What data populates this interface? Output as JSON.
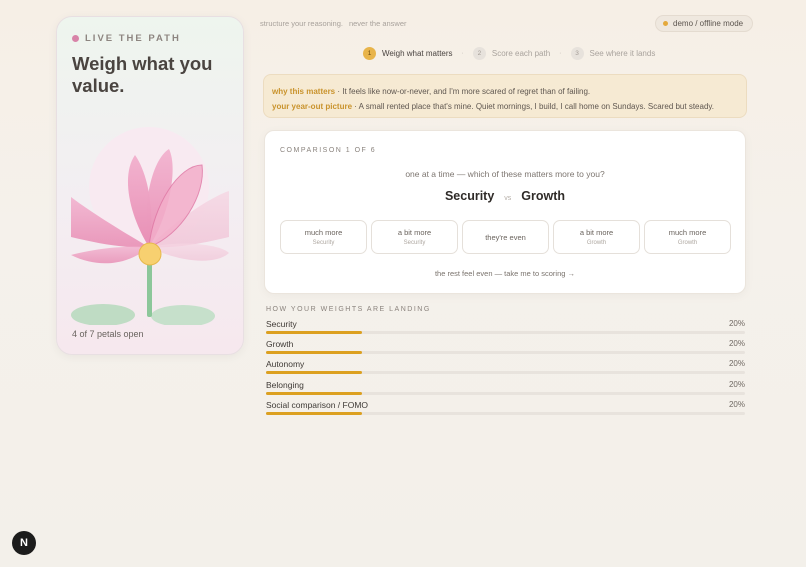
{
  "brand": {
    "label": "LIVE THE PATH"
  },
  "left": {
    "title": "Weigh what you value.",
    "petal_count": "4 of 7 petals open"
  },
  "topbar": {
    "tagline_a": "structure your reasoning.",
    "tagline_b": "never the answer",
    "mode_label": "demo / offline mode"
  },
  "steps": [
    {
      "num": "1",
      "label": "Weigh what matters",
      "active": true
    },
    {
      "num": "2",
      "label": "Score each path",
      "active": false
    },
    {
      "num": "3",
      "label": "See where it lands",
      "active": false
    }
  ],
  "step_separator": "·",
  "context": {
    "why_label": "why this matters",
    "why_text": " · It feels like now-or-never, and I'm more scared of regret than of failing.",
    "picture_label": "your year-out picture",
    "picture_text": " · A small rented place that's mine. Quiet mornings, I build, I call home on Sundays. Scared but steady."
  },
  "comparison": {
    "counter": "COMPARISON 1 OF 6",
    "question": "one at a time — which of these matters more to you?",
    "left_option": "Security",
    "vs": "vs",
    "right_option": "Growth",
    "choices": [
      {
        "main": "much more",
        "sub": "Security"
      },
      {
        "main": "a bit more",
        "sub": "Security"
      },
      {
        "main": "they're even",
        "sub": ""
      },
      {
        "main": "a bit more",
        "sub": "Growth"
      },
      {
        "main": "much more",
        "sub": "Growth"
      }
    ],
    "skip_label": "the rest feel even — take me to scoring →"
  },
  "weights": {
    "title": "HOW YOUR WEIGHTS ARE LANDING",
    "items": [
      {
        "name": "Security",
        "pct": "20%",
        "fill": 0.2
      },
      {
        "name": "Growth",
        "pct": "20%",
        "fill": 0.2
      },
      {
        "name": "Autonomy",
        "pct": "20%",
        "fill": 0.2
      },
      {
        "name": "Belonging",
        "pct": "20%",
        "fill": 0.2
      },
      {
        "name": "Social comparison / FOMO",
        "pct": "20%",
        "fill": 0.2
      }
    ]
  },
  "badge": {
    "letter": "N"
  },
  "colors": {
    "accent": "#dca020",
    "petal": "#f0a8c8",
    "stem": "#8cc79a",
    "center": "#f7d070"
  }
}
